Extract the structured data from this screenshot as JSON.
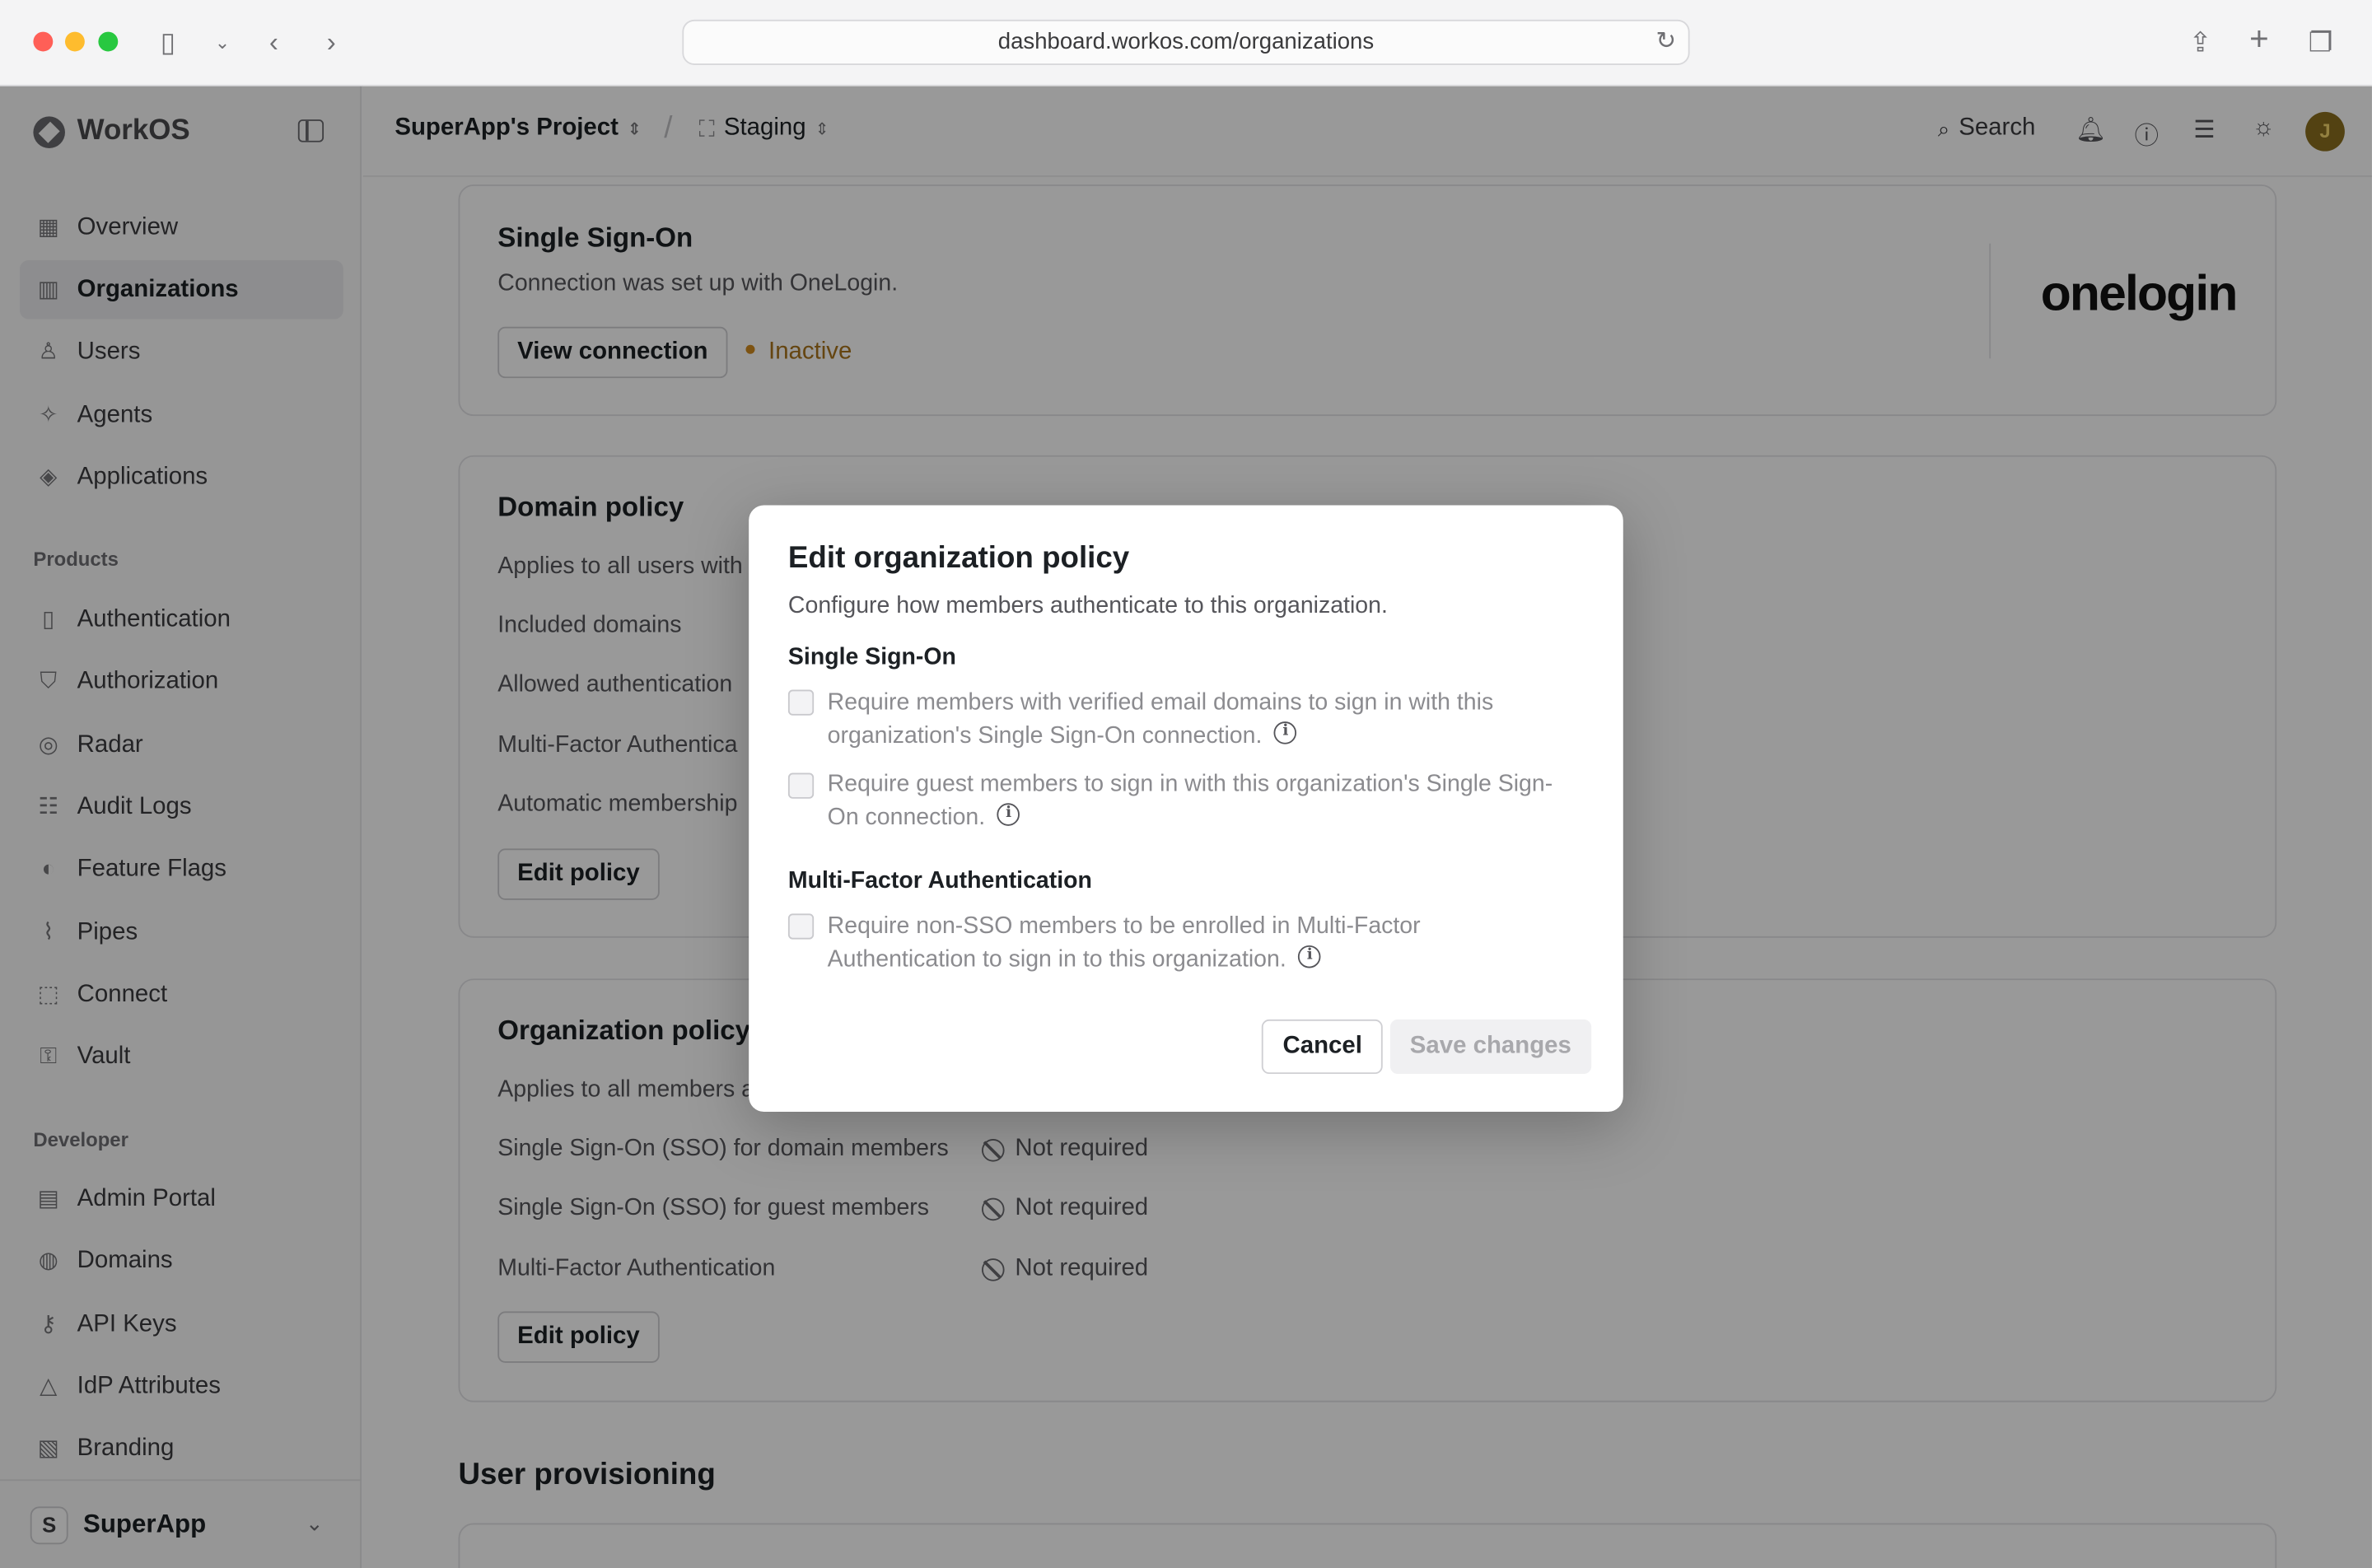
{
  "browser": {
    "url": "dashboard.workos.com/organizations"
  },
  "sidebar": {
    "brand": "WorkOS",
    "items": [
      {
        "label": "Overview",
        "icon": "grid-icon"
      },
      {
        "label": "Organizations",
        "icon": "building-icon",
        "active": true
      },
      {
        "label": "Users",
        "icon": "user-icon"
      },
      {
        "label": "Agents",
        "icon": "sparkle-icon"
      },
      {
        "label": "Applications",
        "icon": "layers-icon"
      }
    ],
    "products_label": "Products",
    "products": [
      {
        "label": "Authentication",
        "icon": "door-icon"
      },
      {
        "label": "Authorization",
        "icon": "shield-icon"
      },
      {
        "label": "Radar",
        "icon": "radar-icon"
      },
      {
        "label": "Audit Logs",
        "icon": "logs-icon"
      },
      {
        "label": "Feature Flags",
        "icon": "toggle-icon"
      },
      {
        "label": "Pipes",
        "icon": "pipes-icon"
      },
      {
        "label": "Connect",
        "icon": "connect-icon"
      },
      {
        "label": "Vault",
        "icon": "vault-icon"
      }
    ],
    "developer_label": "Developer",
    "developer": [
      {
        "label": "Admin Portal",
        "icon": "portal-icon"
      },
      {
        "label": "Domains",
        "icon": "globe-icon"
      },
      {
        "label": "API Keys",
        "icon": "key-icon"
      },
      {
        "label": "IdP Attributes",
        "icon": "shapes-icon"
      },
      {
        "label": "Branding",
        "icon": "brush-icon"
      }
    ],
    "workspace": {
      "badge": "S",
      "name": "SuperApp"
    }
  },
  "topbar": {
    "project": "SuperApp's Project",
    "environment": "Staging",
    "search": "Search",
    "avatar": "J"
  },
  "sso_card": {
    "title": "Single Sign-On",
    "text": "Connection was set up with OneLogin.",
    "button": "View connection",
    "status": "Inactive",
    "provider_logo": "onelogin"
  },
  "domain_card": {
    "title": "Domain policy",
    "rows": [
      "Applies to all users with",
      "Included domains",
      "Allowed authentication",
      "Multi-Factor Authentica",
      "Automatic membership"
    ],
    "button": "Edit policy"
  },
  "org_card": {
    "title": "Organization policy",
    "intro": "Applies to all members a",
    "rows": [
      {
        "label": "Single Sign-On (SSO) for domain members",
        "value": "Not required"
      },
      {
        "label": "Single Sign-On (SSO) for guest members",
        "value": "Not required"
      },
      {
        "label": "Multi-Factor Authentication",
        "value": "Not required"
      }
    ],
    "button": "Edit policy"
  },
  "next_section": "User provisioning",
  "modal": {
    "title": "Edit organization policy",
    "description": "Configure how members authenticate to this organization.",
    "sso_heading": "Single Sign-On",
    "sso_options": [
      "Require members with verified email domains to sign in with this organization's Single Sign-On connection.",
      "Require guest members to sign in with this organization's Single Sign-On connection."
    ],
    "mfa_heading": "Multi-Factor Authentication",
    "mfa_option": "Require non-SSO members to be enrolled in Multi-Factor Authentication to sign in to this organization.",
    "cancel": "Cancel",
    "save": "Save changes"
  }
}
